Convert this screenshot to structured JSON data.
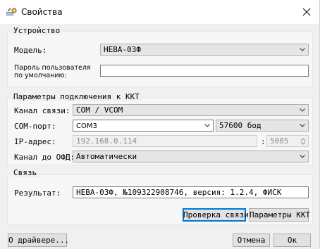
{
  "window": {
    "title": "Свойства",
    "icon": "wrench-gear-icon"
  },
  "device": {
    "legend": "Устройство",
    "model_label": "Модель:",
    "model_value": "НЕВА-03Ф",
    "password_label": "Пароль пользователя по умолчанию:",
    "password_value": ""
  },
  "connection": {
    "legend": "Параметры подключения к ККТ",
    "channel_label": "Канал связи:",
    "channel_value": "COM / VCOM",
    "port_label": "COM-порт:",
    "port_value": "COM3",
    "baud_value": "57600 бод",
    "ip_label": "IP-адрес:",
    "ip_value": "192.168.0.114",
    "ip_sep": ":",
    "ip_port_value": "5005",
    "ofd_label": "Канал до ОФД:",
    "ofd_value": "Автоматически"
  },
  "link": {
    "legend": "Связь",
    "result_label": "Результат:",
    "result_value": "НЕВА-03Ф, №109322908746, версия: 1.2.4, ФИСК",
    "check_button": "Проверка связи",
    "params_button": "Параметры ККТ"
  },
  "footer": {
    "about_button": "О драйвере...",
    "cancel_button": "Отмена",
    "ok_button": "Ок"
  }
}
